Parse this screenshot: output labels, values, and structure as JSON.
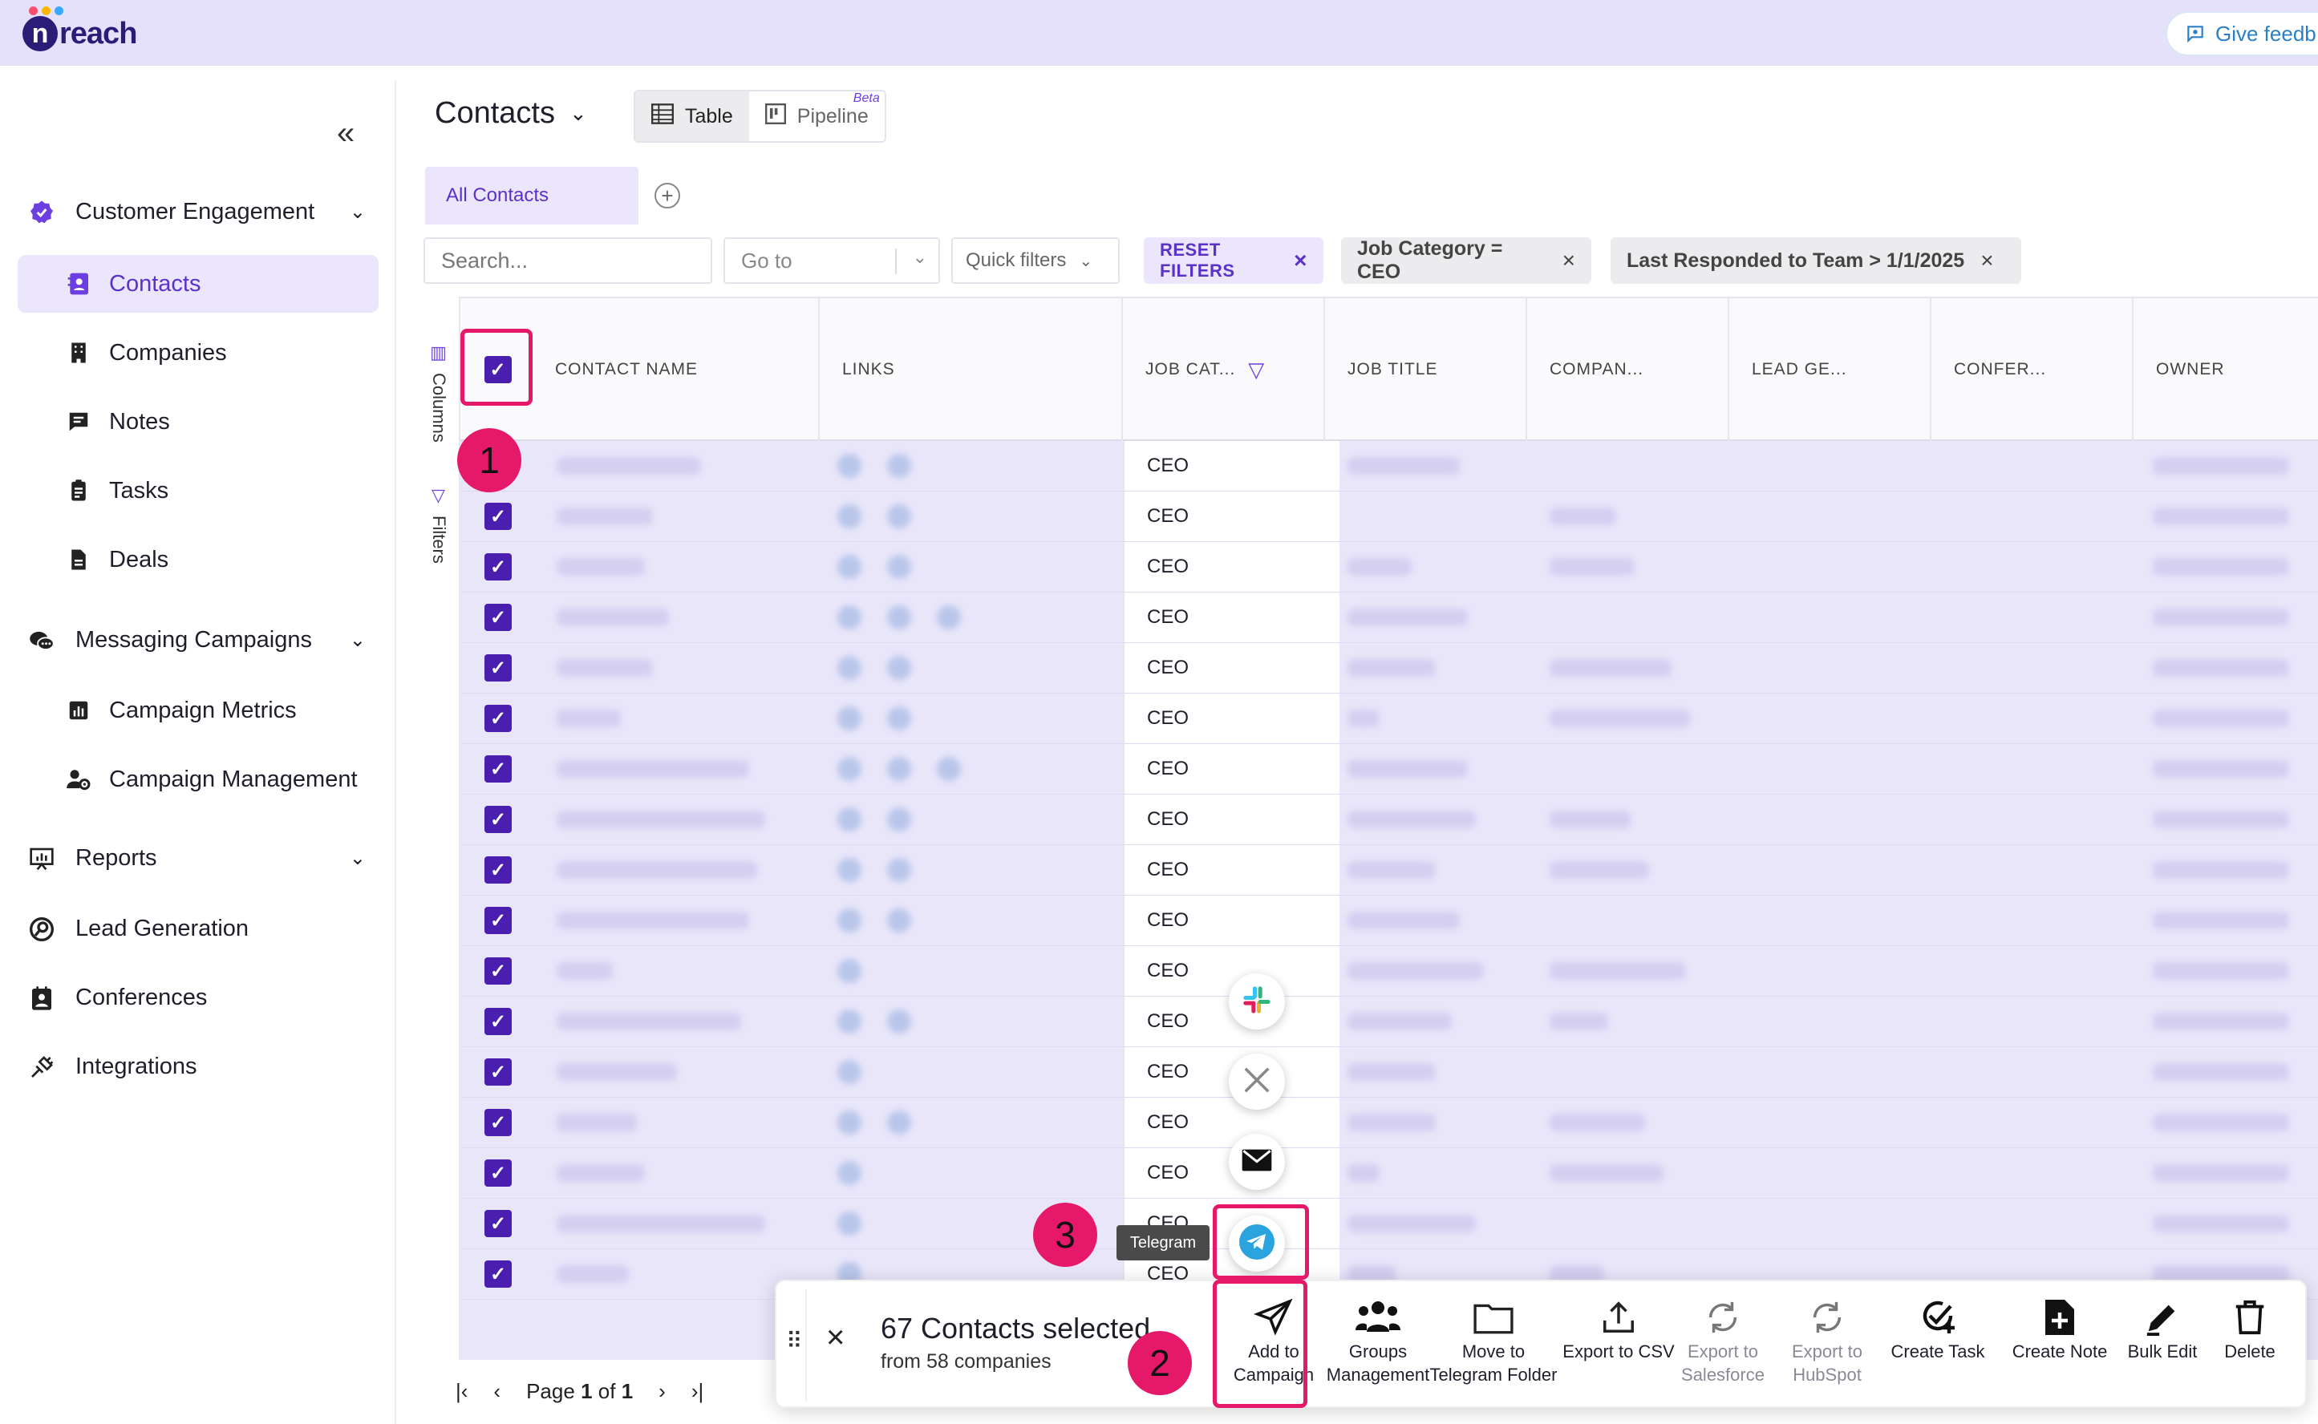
{
  "app": {
    "logo_text": "reach",
    "logo_letter": "n",
    "feedback_label": "Give feedb"
  },
  "sidebar": {
    "groups": [
      {
        "label": "Customer Engagement",
        "icon": "verified-badge-icon",
        "expanded": true
      },
      {
        "label": "Messaging Campaigns",
        "icon": "chat-bubbles-icon",
        "expanded": true
      },
      {
        "label": "Reports",
        "icon": "presentation-chart-icon",
        "expanded": true
      },
      {
        "label": "Lead Generation",
        "icon": "search-circle-icon"
      },
      {
        "label": "Conferences",
        "icon": "id-badge-icon"
      },
      {
        "label": "Integrations",
        "icon": "plug-icon"
      }
    ],
    "items": [
      {
        "label": "Contacts",
        "icon": "contact-book-icon",
        "active": true
      },
      {
        "label": "Companies",
        "icon": "building-icon"
      },
      {
        "label": "Notes",
        "icon": "note-icon"
      },
      {
        "label": "Tasks",
        "icon": "clipboard-icon"
      },
      {
        "label": "Deals",
        "icon": "document-icon"
      },
      {
        "label": "Campaign Metrics",
        "icon": "bar-chart-icon"
      },
      {
        "label": "Campaign Management",
        "icon": "user-gear-icon"
      }
    ]
  },
  "main": {
    "title": "Contacts",
    "views": [
      {
        "label": "Table",
        "active": true
      },
      {
        "label": "Pipeline",
        "badge": "Beta"
      }
    ],
    "tabs": [
      {
        "label": "All Contacts",
        "active": true
      }
    ],
    "search_placeholder": "Search...",
    "goto_placeholder": "Go to",
    "quick_filters_label": "Quick filters",
    "reset_filters_label": "RESET FILTERS",
    "filters": [
      "Job Category = CEO",
      "Last Responded to Team > 1/1/2025"
    ],
    "rail": {
      "columns_label": "Columns",
      "filters_label": "Filters"
    }
  },
  "table": {
    "columns": [
      "CONTACT NAME",
      "LINKS",
      "JOB CAT...",
      "JOB TITLE",
      "COMPAN...",
      "LEAD GE...",
      "CONFER...",
      "OWNER"
    ],
    "job_category_values": [
      "CEO",
      "CEO",
      "CEO",
      "CEO",
      "CEO",
      "CEO",
      "CEO",
      "CEO",
      "CEO",
      "CEO",
      "CEO",
      "CEO",
      "CEO",
      "CEO",
      "CEO",
      "CEO",
      "CEO"
    ],
    "all_selected": true
  },
  "pager": {
    "prefix": "Page",
    "current": "1",
    "of": "of",
    "total": "1"
  },
  "selection": {
    "count_text": "67 Contacts selected",
    "sub_text": "from 58 companies",
    "actions": [
      {
        "label": "Add to Campaign",
        "icon": "send-plane-icon"
      },
      {
        "label": "Groups Management",
        "icon": "users-group-icon"
      },
      {
        "label": "Move to Telegram Folder",
        "icon": "folder-icon"
      },
      {
        "label": "Export to CSV",
        "icon": "upload-icon"
      },
      {
        "label": "Export to Salesforce",
        "icon": "sync-icon",
        "disabled": true
      },
      {
        "label": "Export to HubSpot",
        "icon": "sync-icon",
        "disabled": true
      },
      {
        "label": "Create Task",
        "icon": "check-add-icon"
      },
      {
        "label": "Create Note",
        "icon": "note-add-icon"
      },
      {
        "label": "Bulk Edit",
        "icon": "pencil-icon"
      },
      {
        "label": "Delete",
        "icon": "trash-icon"
      }
    ]
  },
  "channels": {
    "tooltip": "Telegram",
    "items": [
      "slack-icon",
      "x-icon",
      "email-icon",
      "telegram-icon"
    ]
  },
  "annotations": {
    "steps": [
      "1",
      "2",
      "3"
    ]
  },
  "colors": {
    "accent": "#5b32c8",
    "checkbox": "#4a1fb0",
    "highlight": "#e5186a",
    "header_bg": "#e6e1fb"
  }
}
